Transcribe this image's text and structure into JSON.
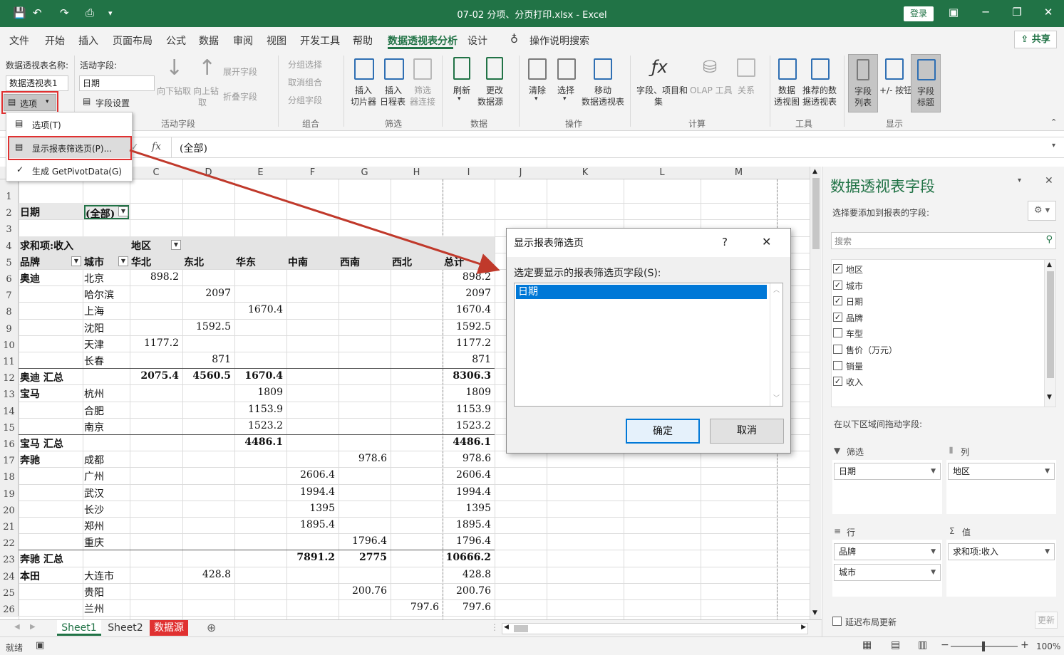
{
  "titlebar": {
    "title": "07-02 分项、分页打印.xlsx - Excel",
    "login": "登录"
  },
  "tabs": {
    "items": [
      "文件",
      "开始",
      "插入",
      "页面布局",
      "公式",
      "数据",
      "审阅",
      "视图",
      "开发工具",
      "帮助",
      "数据透视表分析",
      "设计"
    ],
    "active": "数据透视表分析",
    "search": "操作说明搜索",
    "share": "共享"
  },
  "ribbon": {
    "pivot_name_label": "数据透视表名称:",
    "pivot_name_value": "数据透视表1",
    "options_label": "选项",
    "active_field_label": "活动字段:",
    "active_field_value": "日期",
    "field_settings": "字段设置",
    "drill_down": "向下钻取",
    "drill_up_1": "向上钻",
    "drill_up_2": "取",
    "expand_field": "展开字段",
    "collapse_field": "折叠字段",
    "group_selection": "分组选择",
    "ungroup": "取消组合",
    "group_field": "分组字段",
    "insert_slicer_1": "插入",
    "insert_slicer_2": "切片器",
    "insert_timeline_1": "插入",
    "insert_timeline_2": "日程表",
    "filter_conn_1": "筛选",
    "filter_conn_2": "器连接",
    "refresh": "刷新",
    "change_source_1": "更改",
    "change_source_2": "数据源",
    "clear": "清除",
    "select": "选择",
    "move_1": "移动",
    "move_2": "数据透视表",
    "fields_items_1": "字段、项目和",
    "fields_items_2": "集",
    "olap_tools": "OLAP 工具",
    "relationships": "关系",
    "pivotchart_1": "数据",
    "pivotchart_2": "透视图",
    "recommended_1": "推荐的数",
    "recommended_2": "据透视表",
    "field_list_1": "字段",
    "field_list_2": "列表",
    "buttons": "+/- 按钮",
    "field_headers_1": "字段",
    "field_headers_2": "标题",
    "groups": {
      "active_field": "活动字段",
      "group": "组合",
      "filter": "筛选",
      "data": "数据",
      "actions": "操作",
      "calculations": "计算",
      "tools": "工具",
      "show": "显示"
    }
  },
  "menu": {
    "items": [
      "选项(T)",
      "显示报表筛选页(P)...",
      "生成 GetPivotData(G)"
    ]
  },
  "formula_bar": {
    "fx": "fx",
    "value": "(全部)"
  },
  "grid": {
    "col_headers": [
      "C",
      "D",
      "E",
      "F",
      "G",
      "H",
      "I",
      "J",
      "K",
      "L",
      "M"
    ],
    "row_numbers": [
      "1",
      "2",
      "3",
      "4",
      "5",
      "6",
      "7",
      "8",
      "9",
      "10",
      "11",
      "12",
      "13",
      "14",
      "15",
      "16",
      "17",
      "18",
      "19",
      "20",
      "21",
      "22",
      "23",
      "24",
      "25",
      "26"
    ],
    "filter_label": "日期",
    "filter_value": "(全部)",
    "values_header": "求和项:收入",
    "region_header": "地区",
    "brand_header": "品牌",
    "city_header": "城市",
    "region_cols": [
      "华北",
      "东北",
      "华东",
      "中南",
      "西南",
      "西北",
      "总计"
    ],
    "rows": [
      {
        "brand": "奥迪",
        "city": "北京",
        "v": [
          "898.2",
          "",
          "",
          "",
          "",
          "",
          "898.2"
        ],
        "bold": false
      },
      {
        "brand": "",
        "city": "哈尔滨",
        "v": [
          "",
          "2097",
          "",
          "",
          "",
          "",
          "2097"
        ],
        "bold": false
      },
      {
        "brand": "",
        "city": "上海",
        "v": [
          "",
          "",
          "1670.4",
          "",
          "",
          "",
          "1670.4"
        ],
        "bold": false
      },
      {
        "brand": "",
        "city": "沈阳",
        "v": [
          "",
          "1592.5",
          "",
          "",
          "",
          "",
          "1592.5"
        ],
        "bold": false
      },
      {
        "brand": "",
        "city": "天津",
        "v": [
          "1177.2",
          "",
          "",
          "",
          "",
          "",
          "1177.2"
        ],
        "bold": false
      },
      {
        "brand": "",
        "city": "长春",
        "v": [
          "",
          "871",
          "",
          "",
          "",
          "",
          "871"
        ],
        "bold": false
      },
      {
        "brand": "奥迪 汇总",
        "city": "",
        "v": [
          "2075.4",
          "4560.5",
          "1670.4",
          "",
          "",
          "",
          "8306.3"
        ],
        "bold": true
      },
      {
        "brand": "宝马",
        "city": "杭州",
        "v": [
          "",
          "",
          "1809",
          "",
          "",
          "",
          "1809"
        ],
        "bold": false
      },
      {
        "brand": "",
        "city": "合肥",
        "v": [
          "",
          "",
          "1153.9",
          "",
          "",
          "",
          "1153.9"
        ],
        "bold": false
      },
      {
        "brand": "",
        "city": "南京",
        "v": [
          "",
          "",
          "1523.2",
          "",
          "",
          "",
          "1523.2"
        ],
        "bold": false
      },
      {
        "brand": "宝马 汇总",
        "city": "",
        "v": [
          "",
          "",
          "4486.1",
          "",
          "",
          "",
          "4486.1"
        ],
        "bold": true
      },
      {
        "brand": "奔驰",
        "city": "成都",
        "v": [
          "",
          "",
          "",
          "",
          "978.6",
          "",
          "978.6"
        ],
        "bold": false
      },
      {
        "brand": "",
        "city": "广州",
        "v": [
          "",
          "",
          "",
          "2606.4",
          "",
          "",
          "2606.4"
        ],
        "bold": false
      },
      {
        "brand": "",
        "city": "武汉",
        "v": [
          "",
          "",
          "",
          "1994.4",
          "",
          "",
          "1994.4"
        ],
        "bold": false
      },
      {
        "brand": "",
        "city": "长沙",
        "v": [
          "",
          "",
          "",
          "1395",
          "",
          "",
          "1395"
        ],
        "bold": false
      },
      {
        "brand": "",
        "city": "郑州",
        "v": [
          "",
          "",
          "",
          "1895.4",
          "",
          "",
          "1895.4"
        ],
        "bold": false
      },
      {
        "brand": "",
        "city": "重庆",
        "v": [
          "",
          "",
          "",
          "",
          "1796.4",
          "",
          "1796.4"
        ],
        "bold": false
      },
      {
        "brand": "奔驰 汇总",
        "city": "",
        "v": [
          "",
          "",
          "",
          "7891.2",
          "2775",
          "",
          "10666.2"
        ],
        "bold": true
      },
      {
        "brand": "本田",
        "city": "大连市",
        "v": [
          "",
          "428.8",
          "",
          "",
          "",
          "",
          "428.8"
        ],
        "bold": false
      },
      {
        "brand": "",
        "city": "贵阳",
        "v": [
          "",
          "",
          "",
          "",
          "200.76",
          "",
          "200.76"
        ],
        "bold": false
      },
      {
        "brand": "",
        "city": "兰州",
        "v": [
          "",
          "",
          "",
          "",
          "",
          "797.6",
          "797.6"
        ],
        "bold": false
      }
    ]
  },
  "dialog": {
    "title": "显示报表筛选页",
    "help": "?",
    "close": "✕",
    "prompt": "选定要显示的报表筛选页字段(S):",
    "list": [
      "日期"
    ],
    "ok": "确定",
    "cancel": "取消"
  },
  "pane": {
    "title": "数据透视表字段",
    "subtitle": "选择要添加到报表的字段:",
    "search_placeholder": "搜索",
    "fields": [
      {
        "name": "地区",
        "checked": true
      },
      {
        "name": "城市",
        "checked": true
      },
      {
        "name": "日期",
        "checked": true
      },
      {
        "name": "品牌",
        "checked": true
      },
      {
        "name": "车型",
        "checked": false
      },
      {
        "name": "售价（万元）",
        "checked": false
      },
      {
        "name": "销量",
        "checked": false
      },
      {
        "name": "收入",
        "checked": true
      }
    ],
    "drag_label": "在以下区域间拖动字段:",
    "filters_label": "筛选",
    "columns_label": "列",
    "rows_label": "行",
    "values_label": "值",
    "filter_item": "日期",
    "column_item": "地区",
    "row_items": [
      "品牌",
      "城市"
    ],
    "value_item": "求和项:收入",
    "defer_label": "延迟布局更新",
    "update_label": "更新"
  },
  "sheets": {
    "tabs": [
      "Sheet1",
      "Sheet2",
      "数据源"
    ],
    "active": "Sheet1",
    "colored_tab_color": "#e03131"
  },
  "status": {
    "ready": "就绪",
    "zoom": "100%"
  },
  "colors": {
    "excel_green": "#217346",
    "highlight_red": "#e03131",
    "selection_blue": "#0078d7"
  }
}
